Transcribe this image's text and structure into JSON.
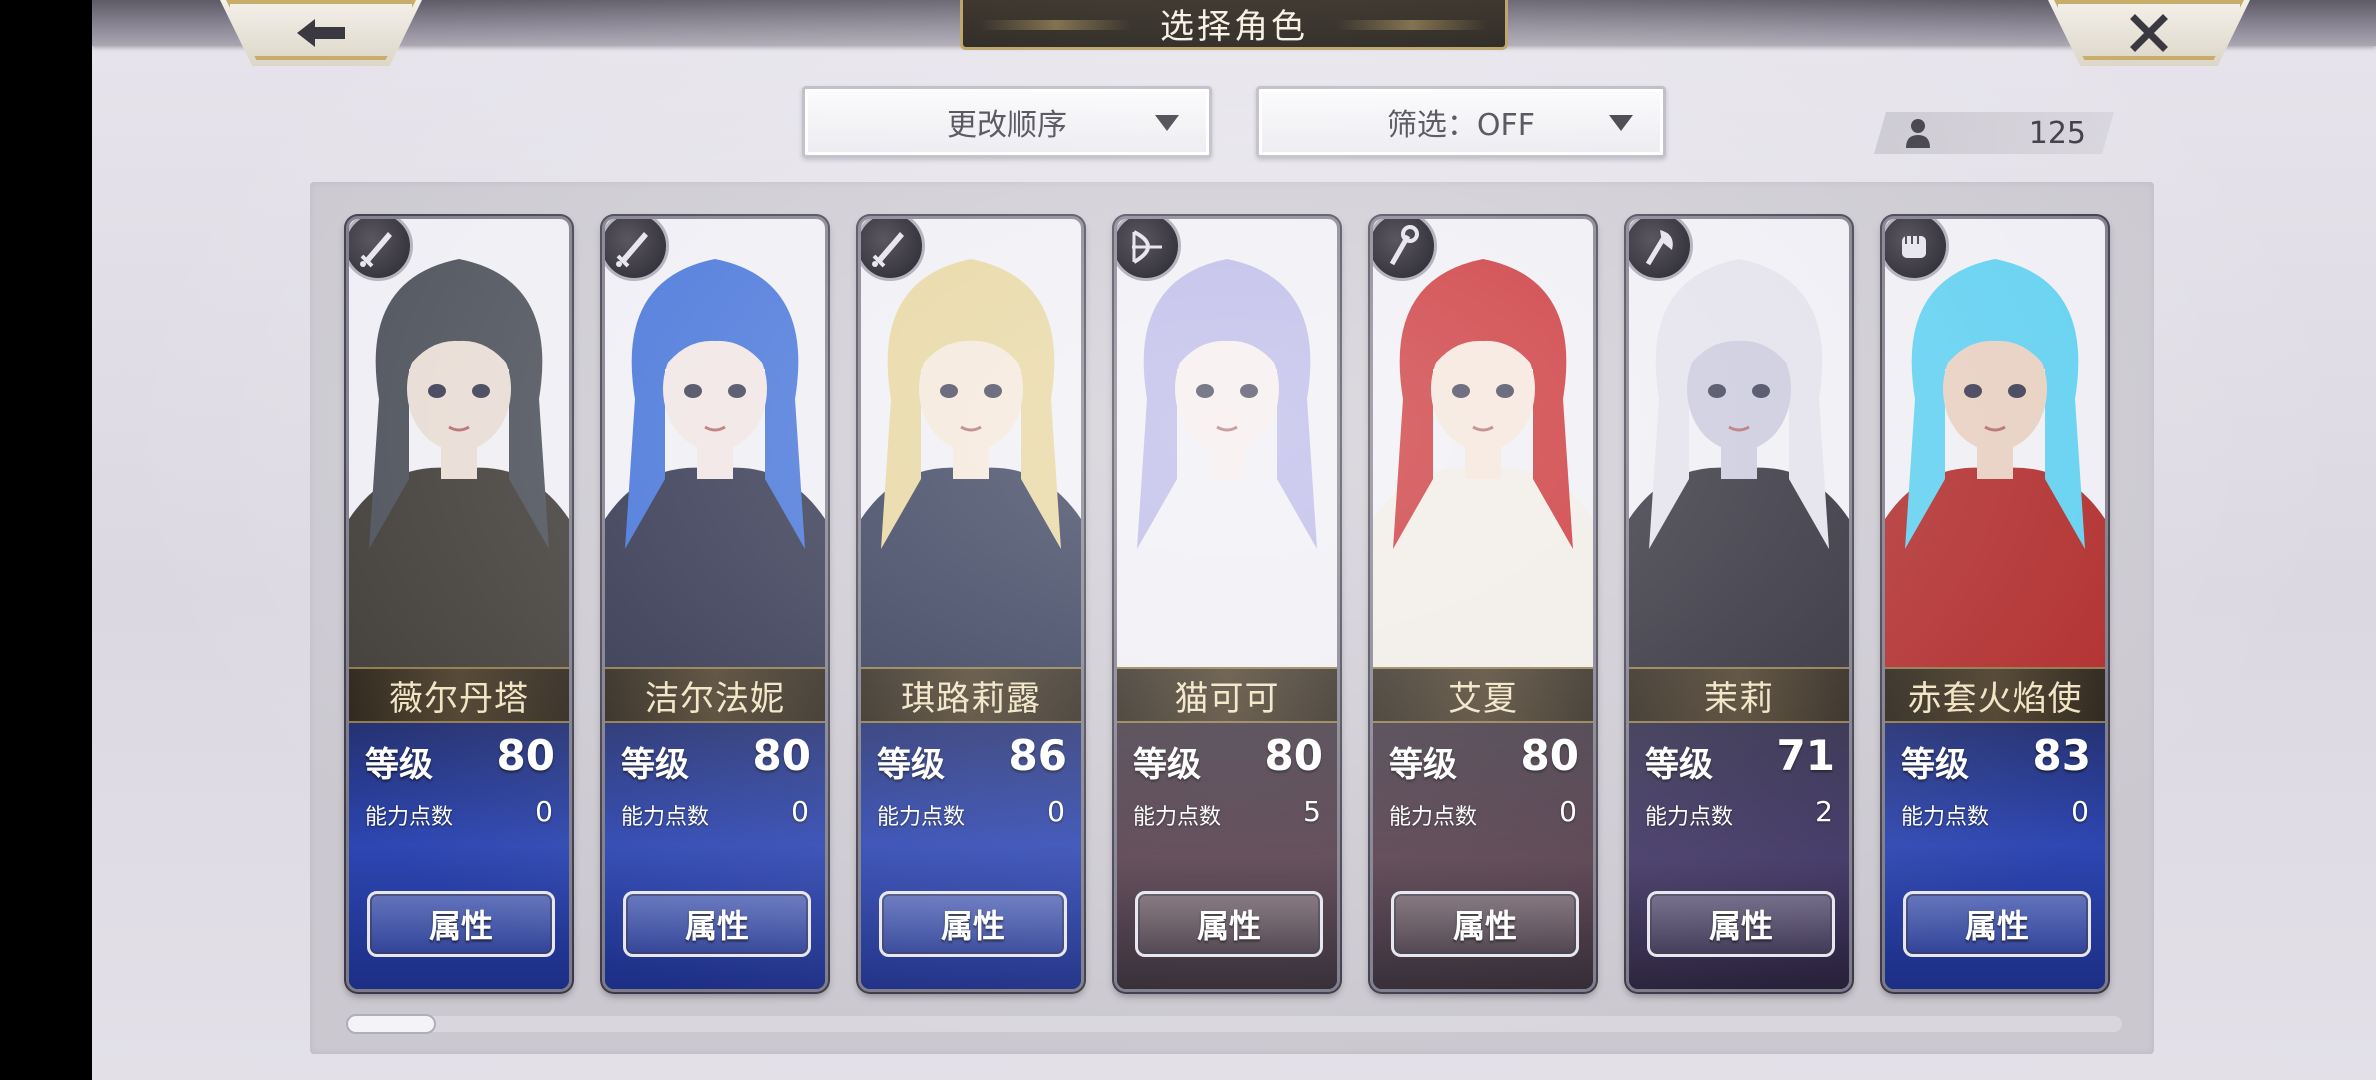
{
  "header": {
    "title": "选择角色",
    "back_icon": "left-arrow-icon",
    "close_icon": "close-x-icon"
  },
  "controls": {
    "sort_label": "更改顺序",
    "filter_label": "筛选：OFF",
    "character_count": "125"
  },
  "labels": {
    "level": "等级",
    "ability_points": "能力点数",
    "attribute_button": "属性"
  },
  "characters": [
    {
      "name": "薇尔丹塔",
      "level": "80",
      "ability_points": "0",
      "class_icon": "sword-icon",
      "hair": "#4a4e58",
      "skin": "#e8dcd4",
      "outfit": "#3e3a36",
      "bg": "blue"
    },
    {
      "name": "洁尔法妮",
      "level": "80",
      "ability_points": "0",
      "class_icon": "sword-icon",
      "hair": "#3f6fd8",
      "skin": "#f0e4e4",
      "outfit": "#2b2f4a",
      "bg": "blue"
    },
    {
      "name": "琪路莉露",
      "level": "86",
      "ability_points": "0",
      "class_icon": "sword-icon",
      "hair": "#e6d39a",
      "skin": "#f4e6d8",
      "outfit": "#2a3250",
      "bg": "blue"
    },
    {
      "name": "猫可可",
      "level": "80",
      "ability_points": "5",
      "class_icon": "bow-icon",
      "hair": "#b7b4e6",
      "skin": "#f6ecec",
      "outfit": "#efeef4",
      "bg": "dark"
    },
    {
      "name": "艾夏",
      "level": "80",
      "ability_points": "0",
      "class_icon": "staff-icon",
      "hair": "#c8282c",
      "skin": "#f4e4da",
      "outfit": "#f0ece6",
      "bg": "dark"
    },
    {
      "name": "茉莉",
      "level": "71",
      "ability_points": "2",
      "class_icon": "axe-icon",
      "hair": "#e2e0ea",
      "skin": "#c8c8dc",
      "outfit": "#2a2834",
      "bg": "purple"
    },
    {
      "name": "赤套火焰使",
      "level": "83",
      "ability_points": "0",
      "class_icon": "fist-icon",
      "hair": "#5fd0f0",
      "skin": "#e8cfc0",
      "outfit": "#b02a2a",
      "bg": "blue"
    }
  ],
  "colors": {
    "accent_gold": "#c8ad6a",
    "title_plate": "#1e1812",
    "panel": "#cbc8d0"
  }
}
